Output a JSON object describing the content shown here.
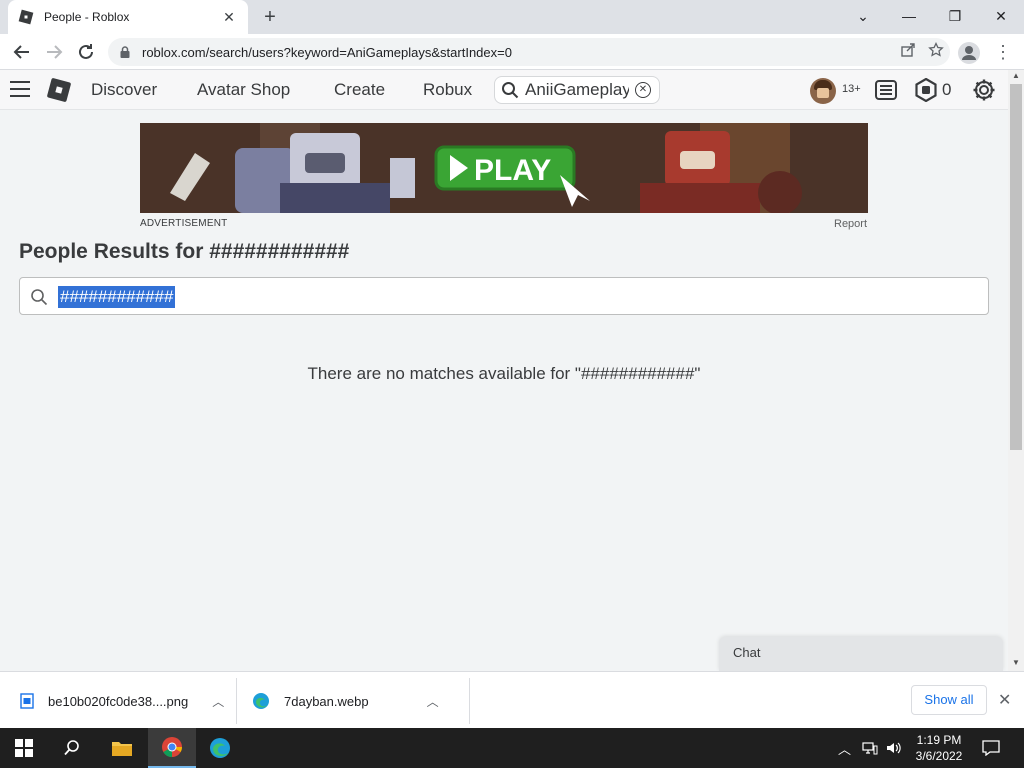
{
  "browser": {
    "tab_title": "People - Roblox",
    "tab_close": "✕",
    "new_tab": "+",
    "url": "roblox.com/search/users?keyword=AniGameplays&startIndex=0",
    "window_controls": {
      "minimize": "—",
      "restore": "❐",
      "close": "✕",
      "tab_list": "⌄"
    }
  },
  "roblox_nav": {
    "links": [
      "Discover",
      "Avatar Shop",
      "Create",
      "Robux"
    ],
    "search_value": "AniiGameplays",
    "age_badge": "13+",
    "robux_count": "0"
  },
  "ad": {
    "label": "ADVERTISEMENT",
    "report": "Report",
    "play_text": "PLAY"
  },
  "results": {
    "title": "People Results for ############",
    "search_value": "############",
    "no_match": "There are no matches available for \"############\""
  },
  "chat": {
    "label": "Chat"
  },
  "downloads": {
    "items": [
      {
        "name": "be10b020fc0de38....png"
      },
      {
        "name": "7dayban.webp"
      }
    ],
    "show_all": "Show all",
    "close": "✕"
  },
  "taskbar": {
    "time": "1:19 PM",
    "date": "3/6/2022"
  },
  "colors": {
    "selection": "#3271d6",
    "link_blue": "#1a73e8",
    "text_dark": "#393b3d"
  }
}
